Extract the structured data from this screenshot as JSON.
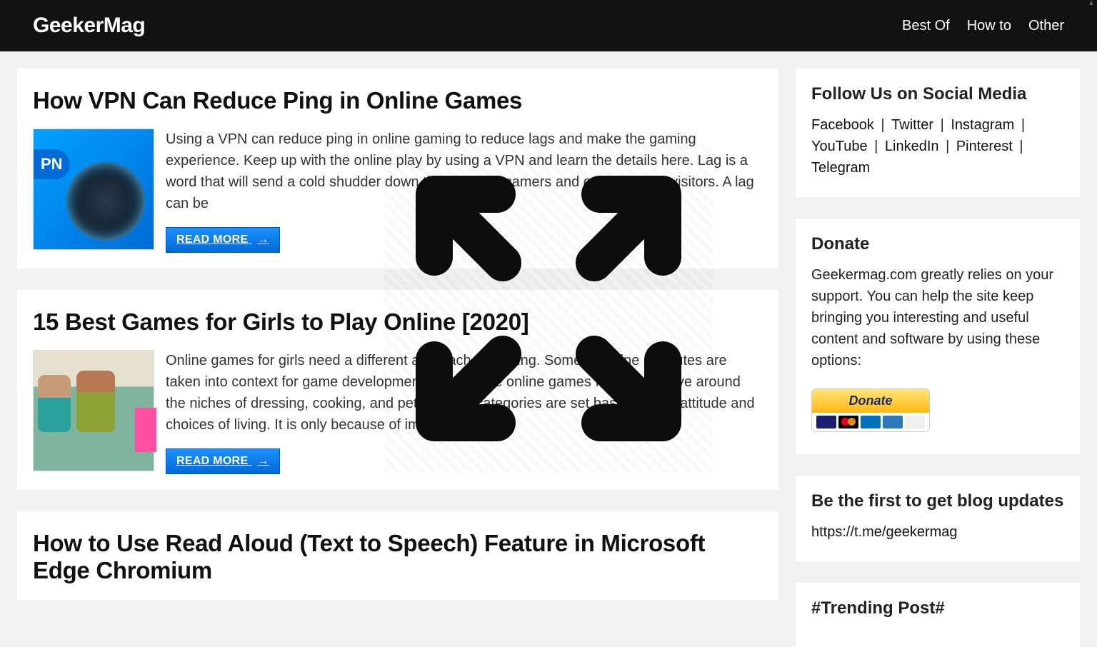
{
  "header": {
    "site_title": "GeekerMag",
    "nav": [
      "Best Of",
      "How to",
      "Other"
    ]
  },
  "articles": [
    {
      "title": "How VPN Can Reduce Ping in Online Games",
      "excerpt": "Using a VPN can reduce ping in online gaming to reduce lags and make the gaming experience. Keep up with the online play by using a VPN and learn the details here. Lag is a word that will send a cold shudder down the necks of gamers and online casino visitors. A lag can be",
      "readmore": "READ MORE",
      "arrow": "→"
    },
    {
      "title": "15 Best Games for Girls to Play Online [2020]",
      "excerpt": "Online games for girls need a different approach to playing. Some feminine attributes are taken into context for game development. Most of the online games for girls revolve around the niches of dressing, cooking, and pets. These categories are set based on the attitude and choices of living. It is only because of immense",
      "readmore": "READ MORE",
      "arrow": "→"
    },
    {
      "title": "How to Use Read Aloud (Text to Speech) Feature in Microsoft Edge Chromium"
    }
  ],
  "sidebar": {
    "follow": {
      "title": "Follow Us on Social Media",
      "links": [
        "Facebook",
        "Twitter",
        "Instagram",
        "YouTube",
        "LinkedIn",
        "Pinterest",
        "Telegram"
      ]
    },
    "donate": {
      "title": "Donate",
      "text": "Geekermag.com greatly relies on your support. You can help the site keep bringing you interesting and useful content and software by using these options:",
      "button_label": "Donate"
    },
    "updates": {
      "title": "Be the first to get blog updates",
      "link": "https://t.me/geekermag"
    },
    "trending": {
      "title": "#Trending Post#"
    }
  },
  "separator": " | "
}
